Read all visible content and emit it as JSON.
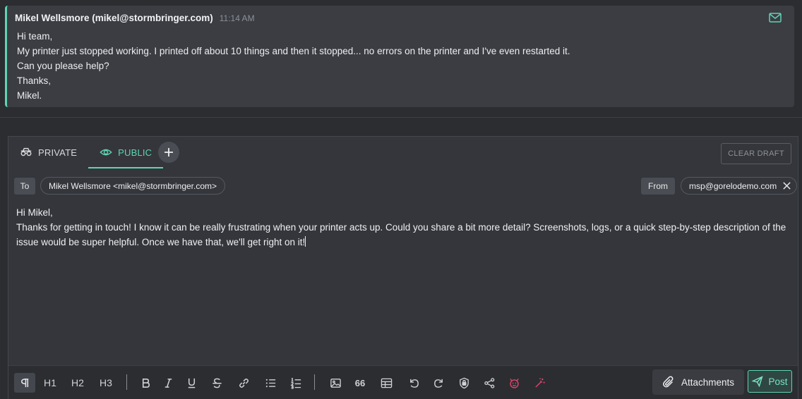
{
  "message": {
    "sender": "Mikel Wellsmore (mikel@stormbringer.com)",
    "time": "11:14 AM",
    "icon": "mail-icon",
    "lines": [
      "Hi team,",
      "My printer just stopped working. I printed off about 10 things and then it stopped... no errors on the printer and I've even restarted it.",
      "Can you please help?",
      "Thanks,",
      "Mikel."
    ]
  },
  "composer": {
    "tabs": [
      {
        "label": "PRIVATE",
        "icon": "incognito-icon"
      },
      {
        "label": "PUBLIC",
        "icon": "eye-icon",
        "active": true
      }
    ],
    "add_tab_icon": "plus-icon",
    "clear_draft": "CLEAR DRAFT",
    "to_label": "To",
    "to_value": "Mikel Wellsmore <mikel@stormbringer.com>",
    "from_label": "From",
    "from_value": "msp@gorelodemo.com",
    "body": {
      "greeting": "Hi Mikel,",
      "text": "Thanks for getting in touch! I know it can be really frustrating when your printer acts up. Could you share a bit more detail? Screenshots, logs, or a quick step-by-step description of the issue would be super helpful. Once we have that, we'll get right on it!"
    }
  },
  "toolbar": {
    "h1": "H1",
    "h2": "H2",
    "h3": "H3",
    "quote": "66",
    "attachments": "Attachments",
    "post": "Post"
  },
  "colors": {
    "accent": "#5fd4b4",
    "danger": "#e0446c"
  }
}
